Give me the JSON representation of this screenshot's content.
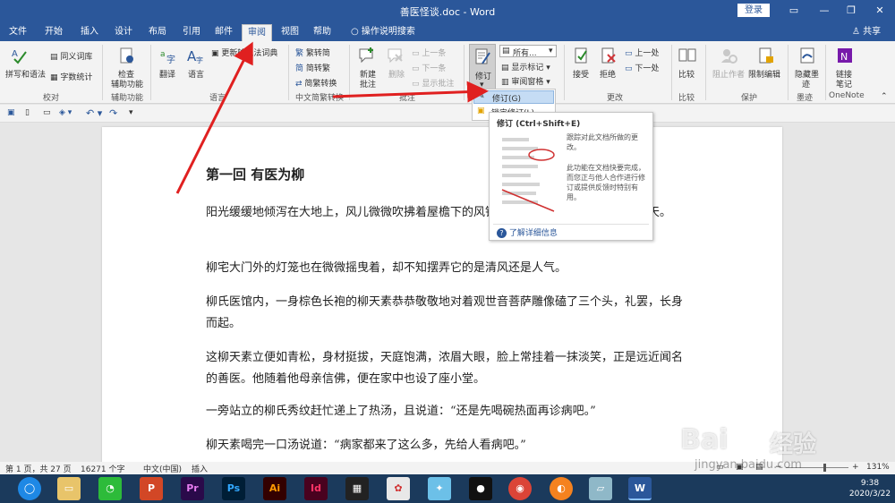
{
  "window": {
    "title": "善医怪谈.doc - Word",
    "login_label": "登录"
  },
  "menu": {
    "tabs": [
      "文件",
      "开始",
      "插入",
      "设计",
      "布局",
      "引用",
      "邮件",
      "审阅",
      "视图",
      "帮助"
    ],
    "active_tab": "审阅",
    "tell_me": "操作说明搜索",
    "share": "共享"
  },
  "ribbon": {
    "proofing": {
      "spell": "拼写和语法",
      "thesaurus": "同义词库",
      "wordcount": "字数统计",
      "label": "校对"
    },
    "accessibility": {
      "check1": "检查",
      "check2": "辅助功能",
      "label": "辅助功能"
    },
    "language": {
      "translate": "翻译",
      "language": "语言",
      "update_ime": "更新输入法词典",
      "label": "语言"
    },
    "chinese": {
      "to_simplified": "繁转简",
      "to_traditional": "简转繁",
      "convert": "简繁转换",
      "label": "中文简繁转换"
    },
    "comments": {
      "new1": "新建",
      "new2": "批注",
      "delete": "删除",
      "prev": "上一条",
      "next": "下一条",
      "show": "显示批注",
      "label": "批注"
    },
    "tracking": {
      "track": "修订",
      "markup_select": "所有...",
      "show_markup": "显示标记",
      "pane": "审阅窗格",
      "label": "修订"
    },
    "changes": {
      "accept": "接受",
      "reject": "拒绝",
      "prev": "上一处",
      "next": "下一处",
      "label": "更改"
    },
    "compare": {
      "compare": "比较",
      "label": "比较"
    },
    "protect": {
      "block": "阻止作者",
      "restrict": "限制编辑",
      "label": "保护"
    },
    "ink": {
      "hide1": "隐藏墨",
      "hide2": "迹",
      "label": "墨迹"
    },
    "onenote": {
      "link1": "链接",
      "link2": "笔记",
      "label": "OneNote"
    }
  },
  "dropdown": {
    "item1": "修订(G)",
    "item2": "锁定修订(L)"
  },
  "tooltip": {
    "title": "修订 (Ctrl+Shift+E)",
    "desc1": "跟踪对此文档所做的更改。",
    "desc2": "此功能在文档快要完成，而您正与他人合作进行修订或提供反馈时特别有用。",
    "link": "了解详细信息"
  },
  "document": {
    "heading": "第一回  有医为柳",
    "paragraphs": [
      "阳光缓缓地倾泻在大地上，风儿微微吹拂着屋檐下的风铃，小镇中的人们开始了新的一天。",
      "柳宅大门外的灯笼也在微微摇曳着，却不知摆弄它的是清风还是人气。",
      "柳氏医馆内，一身棕色长袍的柳天素恭恭敬敬地对着观世音菩萨雕像磕了三个头，礼罢，长身而起。",
      "这柳天素立便如青松，身材挺拔，天庭饱满，浓眉大眼，脸上常挂着一抹淡笑，正是远近闻名的善医。他随着他母亲信佛，便在家中也设了座小堂。",
      "一旁站立的柳氏秀纹赶忙递上了热汤，且说道：“还是先喝碗热面再诊病吧。”",
      "柳天素喝完一口汤说道：“病家都来了这么多，先给人看病吧。”"
    ]
  },
  "status": {
    "page": "第 1 页，共 27 页",
    "words": "16271 个字",
    "lang": "中文(中国)",
    "mode": "插入",
    "zoom": "131%"
  },
  "clock": {
    "time": "9:38",
    "date": "2020/3/22"
  },
  "watermark": {
    "text1": "Bai",
    "text2": "经验",
    "url": "jingyan.baidu.com"
  },
  "colors": {
    "accent": "#2b579a",
    "annotation": "#e02020"
  }
}
